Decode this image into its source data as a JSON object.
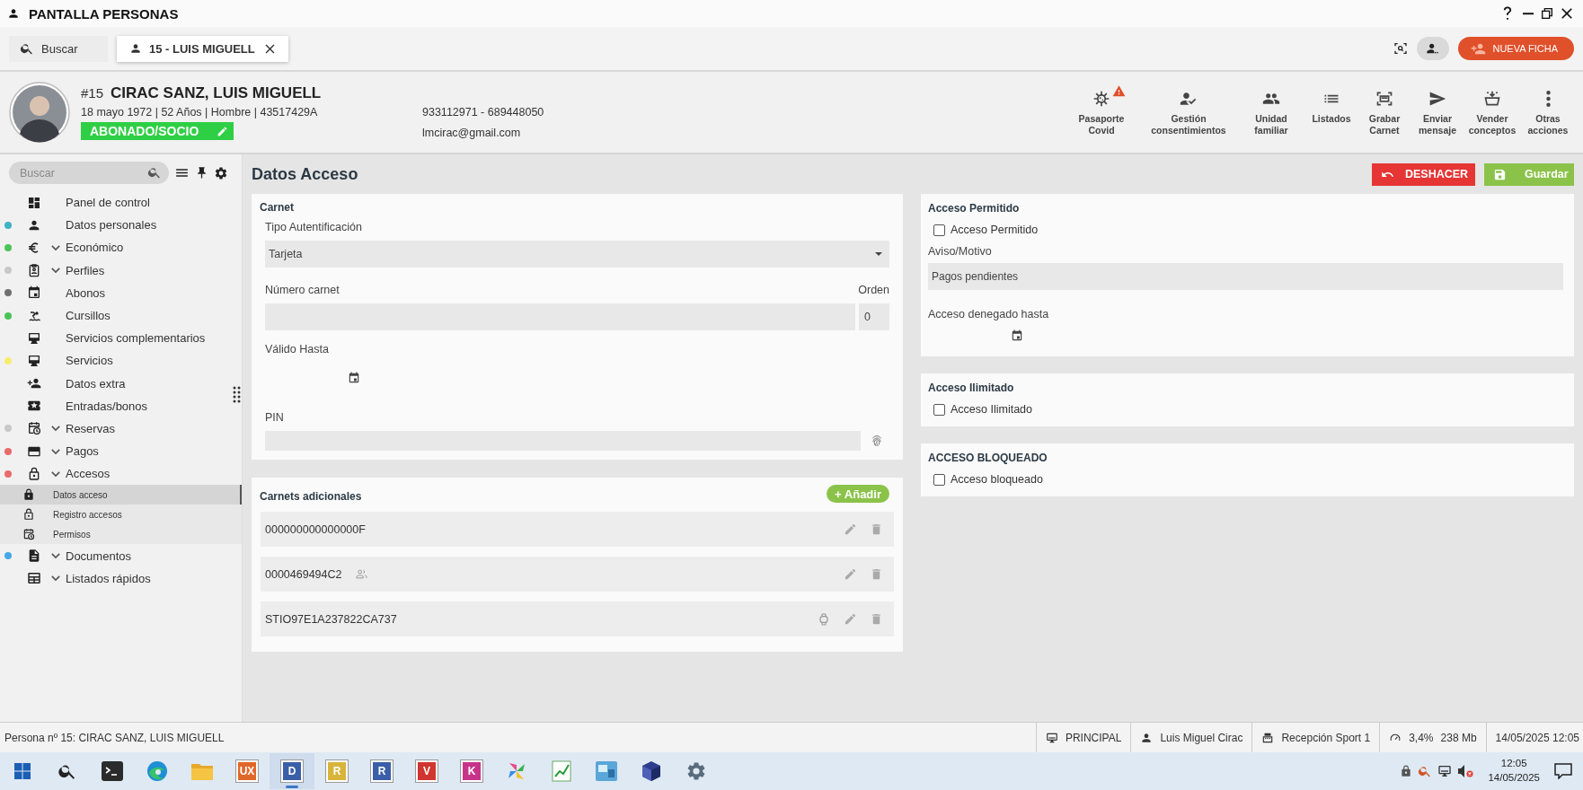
{
  "window": {
    "title": "PANTALLA PERSONAS"
  },
  "tabs": [
    {
      "kind": "search",
      "label": "Buscar",
      "selected": false
    },
    {
      "kind": "record",
      "label": "15 - LUIS MIGUELL",
      "selected": true
    }
  ],
  "toolbar": {
    "new_button": "NUEVA FICHA"
  },
  "person": {
    "number": "#15",
    "name": "CIRAC SANZ, LUIS MIGUELL",
    "details": "18 mayo 1972 | 52 Años | Hombre | 43517429A",
    "status_badge": "ABONADO/SOCIO",
    "phone": "933112971 - 689448050",
    "email": "lmcirac@gmail.com"
  },
  "actions": [
    {
      "label": "Pasaporte Covid",
      "warning": true
    },
    {
      "label": "Gestión consentimientos",
      "warning": false
    },
    {
      "label": "Unidad familiar",
      "warning": false
    },
    {
      "label": "Listados",
      "warning": false
    },
    {
      "label": "Grabar Carnet",
      "warning": false
    },
    {
      "label": "Enviar mensaje",
      "warning": false
    },
    {
      "label": "Vender conceptos",
      "warning": false
    },
    {
      "label": "Otras acciones",
      "warning": false
    }
  ],
  "sidebar": {
    "search_placeholder": "Buscar",
    "items": [
      {
        "label": "Panel de control",
        "collapsible": false
      },
      {
        "label": "Datos personales",
        "collapsible": false,
        "color": "#3db4c4"
      },
      {
        "label": "Económico",
        "collapsible": true,
        "color": "#4cc35a"
      },
      {
        "label": "Perfiles",
        "collapsible": true,
        "color": "#c8c8c8"
      },
      {
        "label": "Abonos",
        "collapsible": false,
        "color": "#707070"
      },
      {
        "label": "Cursillos",
        "collapsible": false,
        "color": "#4cc35a"
      },
      {
        "label": "Servicios complementarios",
        "collapsible": false
      },
      {
        "label": "Servicios",
        "collapsible": false,
        "color": "#f7ec6e"
      },
      {
        "label": "Datos extra",
        "collapsible": false
      },
      {
        "label": "Entradas/bonos",
        "collapsible": false
      },
      {
        "label": "Reservas",
        "collapsible": true,
        "color": "#c8c8c8"
      },
      {
        "label": "Pagos",
        "collapsible": true,
        "color": "#e86a6a"
      },
      {
        "label": "Accesos",
        "collapsible": true,
        "color": "#e86a6a",
        "children": [
          {
            "label": "Datos acceso",
            "selected": true
          },
          {
            "label": "Registro accesos",
            "selected": false
          },
          {
            "label": "Permisos",
            "selected": false
          }
        ]
      },
      {
        "label": "Documentos",
        "collapsible": true,
        "color": "#45a8e6"
      },
      {
        "label": "Listados rápidos",
        "collapsible": true
      }
    ]
  },
  "page": {
    "title": "Datos Acceso",
    "undo_button": "DESHACER",
    "save_button": "Guardar"
  },
  "carnet": {
    "title": "Carnet",
    "auth_label": "Tipo Autentificación",
    "auth_value": "Tarjeta",
    "number_label": "Número carnet",
    "order_label": "Orden",
    "order_value": "0",
    "valid_label": "Válido Hasta",
    "pin_label": "PIN"
  },
  "additional_cards": {
    "title": "Carnets adicionales",
    "add_button": "+ Añadir",
    "rows": [
      {
        "code": "000000000000000F",
        "kind": "plain"
      },
      {
        "code": "0000469494C2",
        "kind": "shared"
      },
      {
        "code": "STIO97E1A237822CA737",
        "kind": "watch"
      }
    ]
  },
  "access_sections": [
    {
      "title": "Acceso Permitido",
      "checkbox": {
        "label": "Acceso Permitido",
        "checked": false
      },
      "reason_label": "Aviso/Motivo",
      "reason_value": "Pagos pendientes",
      "until_label": "Acceso denegado hasta"
    },
    {
      "title": "Acceso Ilimitado",
      "checkbox": {
        "label": "Acceso Ilimitado",
        "checked": false
      }
    },
    {
      "title": "ACCESO BLOQUEADO",
      "checkbox": {
        "label": "Acceso bloqueado",
        "checked": false
      }
    }
  ],
  "status_bar": {
    "record": "Persona nº 15: CIRAC SANZ, LUIS MIGUELL",
    "terminal": "PRINCIPAL",
    "user": "Luis Miguel Cirac",
    "location": "Recepción Sport 1",
    "cpu": "3,4%",
    "memory": "238 Mb",
    "datetime": "14/05/2025 12:05"
  },
  "taskbar": {
    "apps": [
      {
        "kind": "start",
        "active": false
      },
      {
        "kind": "search",
        "active": false
      },
      {
        "kind": "terminal",
        "active": false
      },
      {
        "kind": "browser",
        "active": false
      },
      {
        "kind": "folder",
        "active": false
      },
      {
        "kind": "letter",
        "label": "UX",
        "color": "#e0672a",
        "active": false
      },
      {
        "kind": "letter",
        "label": "D",
        "color": "#3a5fa8",
        "active": true
      },
      {
        "kind": "letter",
        "label": "R",
        "color": "#d8b43a",
        "active": false
      },
      {
        "kind": "letter",
        "label": "R",
        "color": "#3a5fa8",
        "active": false
      },
      {
        "kind": "letter",
        "label": "V",
        "color": "#d0352f",
        "active": false
      },
      {
        "kind": "letter",
        "label": "K",
        "color": "#c8338a",
        "active": false
      },
      {
        "kind": "tool",
        "active": false
      },
      {
        "kind": "chart",
        "active": false
      },
      {
        "kind": "image",
        "active": false
      },
      {
        "kind": "cube",
        "active": false
      },
      {
        "kind": "gear",
        "active": false
      }
    ],
    "time": "12:05",
    "date": "14/05/2025"
  }
}
